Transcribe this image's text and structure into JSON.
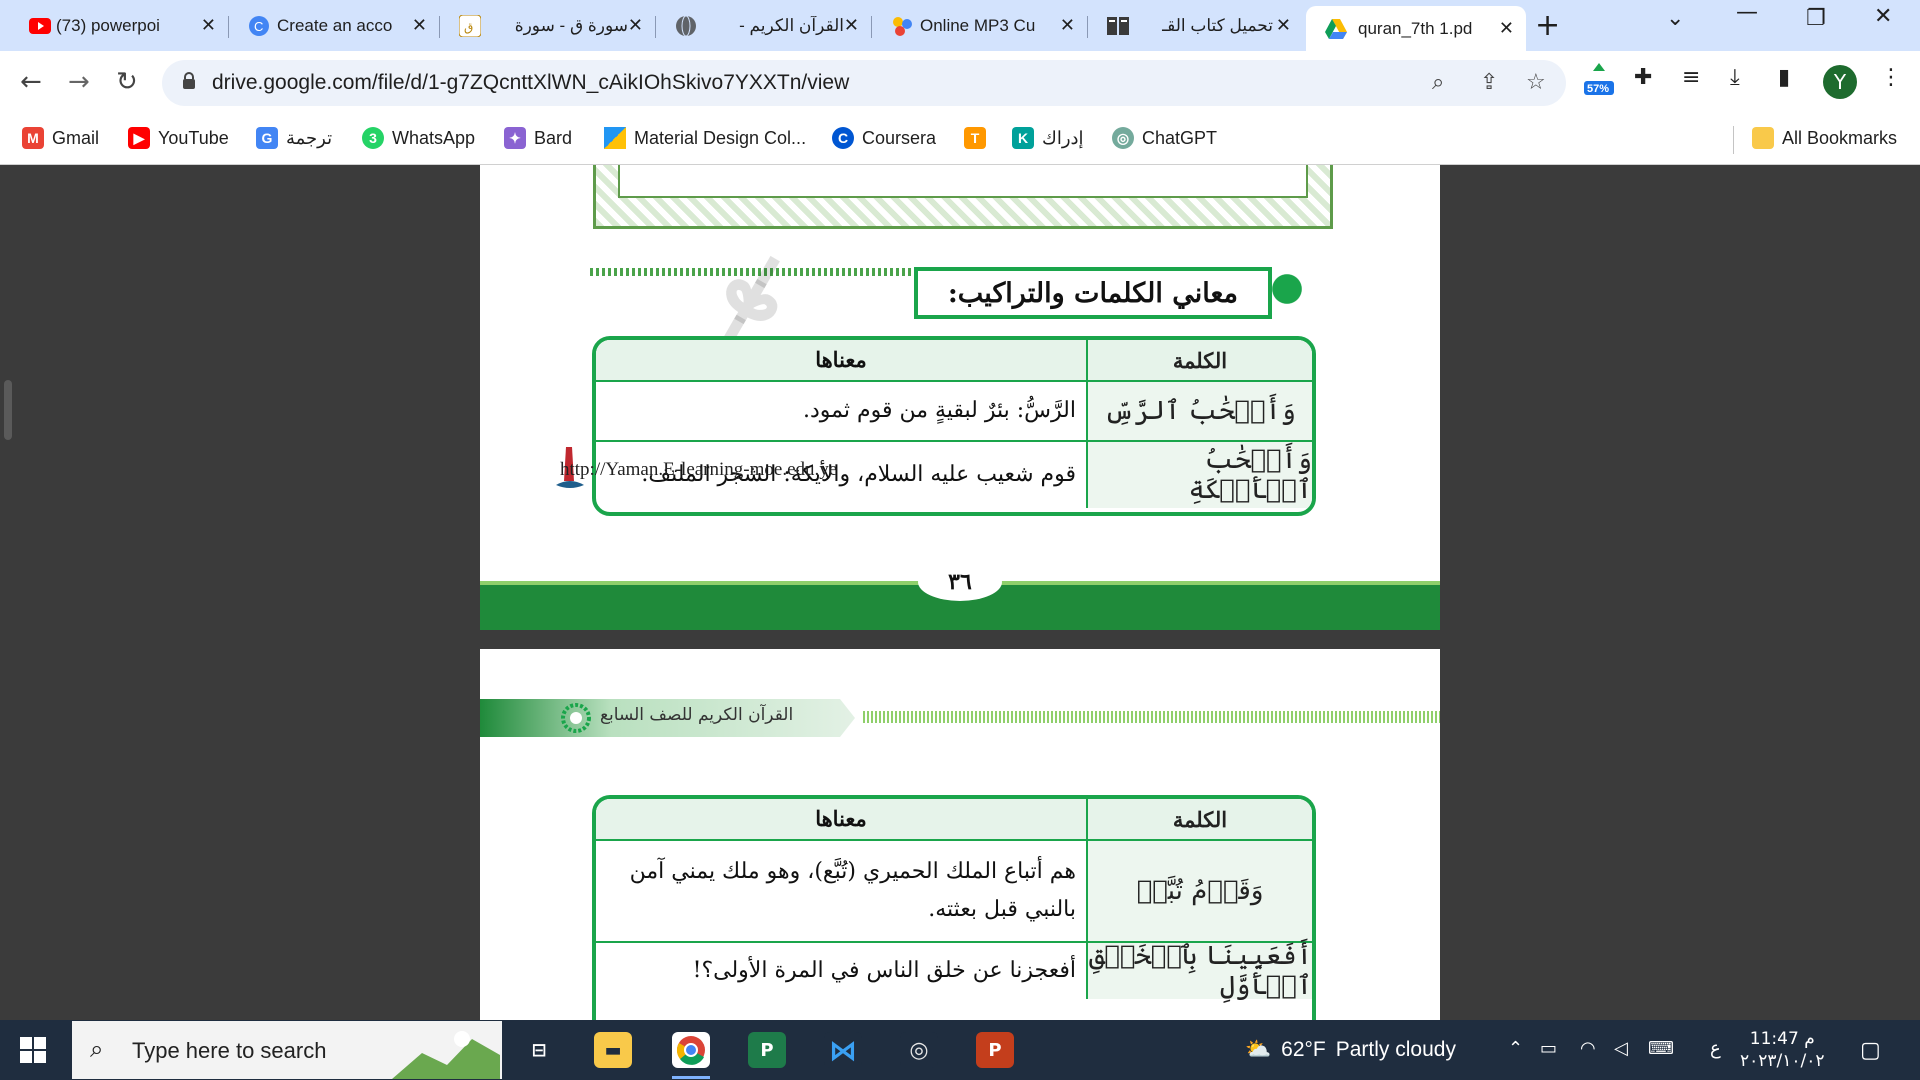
{
  "tabs": [
    {
      "title": "(73) powerpoi",
      "icon": "youtube-icon"
    },
    {
      "title": "Create an acco",
      "icon": "google-icon"
    },
    {
      "title": "سورة ق - سورة",
      "icon": "quran-icon"
    },
    {
      "title": "القرآن الكريم -",
      "icon": "globe-icon"
    },
    {
      "title": "Online MP3 Cu",
      "icon": "mp3-icon"
    },
    {
      "title": "تحميل كتاب القـ",
      "icon": "book-icon"
    },
    {
      "title": "quran_7th 1.pd",
      "icon": "drive-icon"
    }
  ],
  "address": {
    "url": "drive.google.com/file/d/1-g7ZQcnttXlWN_cAikIOhSkivo7YXXTn/view"
  },
  "extension_badge": "57%",
  "avatar_letter": "Y",
  "bookmarks": [
    {
      "label": "Gmail",
      "color": "#ea4335"
    },
    {
      "label": "YouTube",
      "color": "#ff0000"
    },
    {
      "label": "ترجمة",
      "color": "#4285f4"
    },
    {
      "label": "WhatsApp",
      "color": "#25d366"
    },
    {
      "label": "Bard",
      "color": "#8a63d2"
    },
    {
      "label": "Material Design Col...",
      "color": "#2196f3"
    },
    {
      "label": "Coursera",
      "color": "#0056d2"
    },
    {
      "label": "",
      "color": "#ff9800"
    },
    {
      "label": "إدراك",
      "color": "#00a19a"
    },
    {
      "label": "ChatGPT",
      "color": "#74aa9c"
    }
  ],
  "all_bookmarks": "All Bookmarks",
  "page1": {
    "section_heading": "معاني الكلمات والتراكيب:",
    "table": {
      "head_word": "الكلمة",
      "head_meaning": "معناها",
      "rows": [
        {
          "word": "وَأَصۡحَٰبُ ٱلرَّسِّ",
          "meaning": "الرَّسُّ: بئرٌ لبقيةٍ من قوم ثمود."
        },
        {
          "word": "وَأَصۡحَٰبُ ٱلۡأَيۡكَةِ",
          "meaning": "قوم شعيب عليه السلام، والأيكة: الشجر الملتف."
        }
      ]
    },
    "site_url": "http://Yaman.E-learning-moe.edu.ye",
    "page_number": "٣٦"
  },
  "page2": {
    "header_title": "القرآن الكريم للصف السابع",
    "table": {
      "head_word": "الكلمة",
      "head_meaning": "معناها",
      "rows": [
        {
          "word": "وَقَوۡمُ تُبَّعٖ",
          "meaning": "هم أتباع الملك الحميري (تُبَّع)، وهو ملك يمني آمن بالنبي قبل بعثته."
        },
        {
          "word": "أَفَعَيِينَا بِٱلۡخَلۡقِ ٱلۡأَوَّلِ",
          "meaning": "أفعجزنا عن خلق الناس في المرة الأولى؟!"
        }
      ]
    }
  },
  "taskbar": {
    "search_placeholder": "Type here to search",
    "weather_temp": "62°F",
    "weather_desc": "Partly cloudy",
    "lang": "ع",
    "time": "11:47 م",
    "date": "٢٠٢٣/١٠/٠٢"
  }
}
